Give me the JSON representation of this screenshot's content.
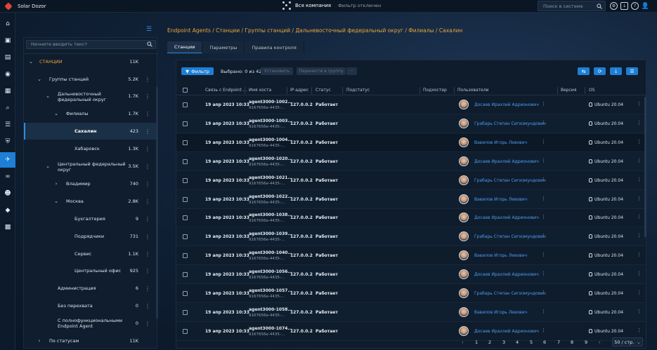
{
  "topbar": {
    "app_name": "Solar Dozor",
    "company_label": "Вся компания",
    "filter_state": "Фильтр отключен",
    "search_placeholder": "Поиск в системе"
  },
  "tree": {
    "search_placeholder": "Начните вводить текст",
    "items": [
      {
        "label": "СТАНЦИИ",
        "count": "11K"
      },
      {
        "label": "Группы станций",
        "count": "5.2K"
      },
      {
        "label": "Дальневосточный",
        "label2": "федеральный округ",
        "count": "1.7K"
      },
      {
        "label": "Филиалы",
        "count": "1.7K"
      },
      {
        "label": "Сахалин",
        "count": "423"
      },
      {
        "label": "Хабаровск",
        "count": "1.3K"
      },
      {
        "label": "Центральный федеральный",
        "label2": "округ",
        "count": "3.5K"
      },
      {
        "label": "Владимир",
        "count": "740"
      },
      {
        "label": "Москва",
        "count": "2.8K"
      },
      {
        "label": "Бухгалтерия",
        "count": "9"
      },
      {
        "label": "Подрядчики",
        "count": "731"
      },
      {
        "label": "Сервис",
        "count": "1.1K"
      },
      {
        "label": "Центральный офис",
        "count": "925"
      },
      {
        "label": "Администрация",
        "count": "6"
      },
      {
        "label": "Без перехвата",
        "count": "0"
      },
      {
        "label": "С полнофункциональными",
        "label2": "Endpoint Agent",
        "count": "0"
      },
      {
        "label": "По статусам",
        "count": "11K"
      }
    ]
  },
  "breadcrumb": "Endpoint Agents / Станции / Группы станций / Дальневосточный федеральный округ / Филиалы / Сахалин",
  "tabs": [
    {
      "label": "Станции"
    },
    {
      "label": "Параметры"
    },
    {
      "label": "Правила контроля"
    }
  ],
  "toolbar": {
    "filter_label": "Фильтр",
    "selected_text": "Выбрано: 0 из 423",
    "install_label": "Установить",
    "move_label": "Перенести в группу",
    "more_label": "···"
  },
  "table": {
    "columns": [
      "Связь с Endpoint ...",
      "Имя хоста",
      "IP-адрес",
      "Статус",
      "Подстатус",
      "Подхостер",
      "Пользователи",
      "Версия",
      "OS"
    ],
    "rows": [
      {
        "date": "19 апр 2023 10:33",
        "host": "agent3000-1002...",
        "host_id": "9167656e-4435-...",
        "ip": "127.0.0.2",
        "status": "Работает",
        "user": "Досаев Ирахлий Адрионович",
        "os": "Ubuntu 20.04"
      },
      {
        "date": "19 апр 2023 10:33",
        "host": "agent3000-1003...",
        "host_id": "9167656e-4435-...",
        "ip": "127.0.0.2",
        "status": "Работает",
        "user": "Грабарь Степан Сигизмундович",
        "os": "Ubuntu 20.04"
      },
      {
        "date": "19 апр 2023 10:33",
        "host": "agent3000-1004...",
        "host_id": "9167656e-4435-...",
        "ip": "127.0.0.2",
        "status": "Работает",
        "user": "Вавилов Игорь Левович",
        "os": "Ubuntu 20.04"
      },
      {
        "date": "19 апр 2023 10:33",
        "host": "agent3000-1020...",
        "host_id": "9167656e-4435-...",
        "ip": "127.0.0.2",
        "status": "Работает",
        "user": "Досаев Ирахлий Адрионович",
        "os": "Ubuntu 20.04"
      },
      {
        "date": "19 апр 2023 10:33",
        "host": "agent3000-1021...",
        "host_id": "9167656e-4435-...",
        "ip": "127.0.0.2",
        "status": "Работает",
        "user": "Грабарь Степан Сигизмундович",
        "os": "Ubuntu 20.04"
      },
      {
        "date": "19 апр 2023 10:33",
        "host": "agent3000-1022...",
        "host_id": "9167656e-4435-...",
        "ip": "127.0.0.2",
        "status": "Работает",
        "user": "Вавилов Игорь Левович",
        "os": "Ubuntu 20.04"
      },
      {
        "date": "19 апр 2023 10:33",
        "host": "agent3000-1038...",
        "host_id": "9167656e-4435-...",
        "ip": "127.0.0.2",
        "status": "Работает",
        "user": "Досаев Ирахлий Адрионович",
        "os": "Ubuntu 20.04"
      },
      {
        "date": "19 апр 2023 10:33",
        "host": "agent3000-1039...",
        "host_id": "9167656e-4435-...",
        "ip": "127.0.0.2",
        "status": "Работает",
        "user": "Грабарь Степан Сигизмундович",
        "os": "Ubuntu 20.04"
      },
      {
        "date": "19 апр 2023 10:33",
        "host": "agent3000-1040...",
        "host_id": "9167656e-4435-...",
        "ip": "127.0.0.2",
        "status": "Работает",
        "user": "Вавилов Игорь Левович",
        "os": "Ubuntu 20.04"
      },
      {
        "date": "19 апр 2023 10:33",
        "host": "agent3000-1056...",
        "host_id": "9167656e-4435-...",
        "ip": "127.0.0.2",
        "status": "Работает",
        "user": "Досаев Ирахлий Адрионович",
        "os": "Ubuntu 20.04"
      },
      {
        "date": "19 апр 2023 10:33",
        "host": "agent3000-1057...",
        "host_id": "9167656e-4435-...",
        "ip": "127.0.0.2",
        "status": "Работает",
        "user": "Грабарь Степан Сигизмундович",
        "os": "Ubuntu 20.04"
      },
      {
        "date": "19 апр 2023 10:33",
        "host": "agent3000-1058...",
        "host_id": "9167656e-4435-...",
        "ip": "127.0.0.2",
        "status": "Работает",
        "user": "Вавилов Игорь Левович",
        "os": "Ubuntu 20.04"
      },
      {
        "date": "19 апр 2023 10:33",
        "host": "agent3000-1074...",
        "host_id": "9167656e-4435-...",
        "ip": "127.0.0.2",
        "status": "Работает",
        "user": "Досаев Ирахлий Адрионович",
        "os": "Ubuntu 20.04"
      }
    ]
  },
  "pagination": {
    "pages": [
      "1",
      "2",
      "3",
      "4",
      "5",
      "6",
      "7",
      "8",
      "9"
    ],
    "per_page": "50 / стр."
  },
  "colors": {
    "accent": "#1d7fd6",
    "breadcrumb": "#e8a53c",
    "user_link": "#4c9df0"
  }
}
